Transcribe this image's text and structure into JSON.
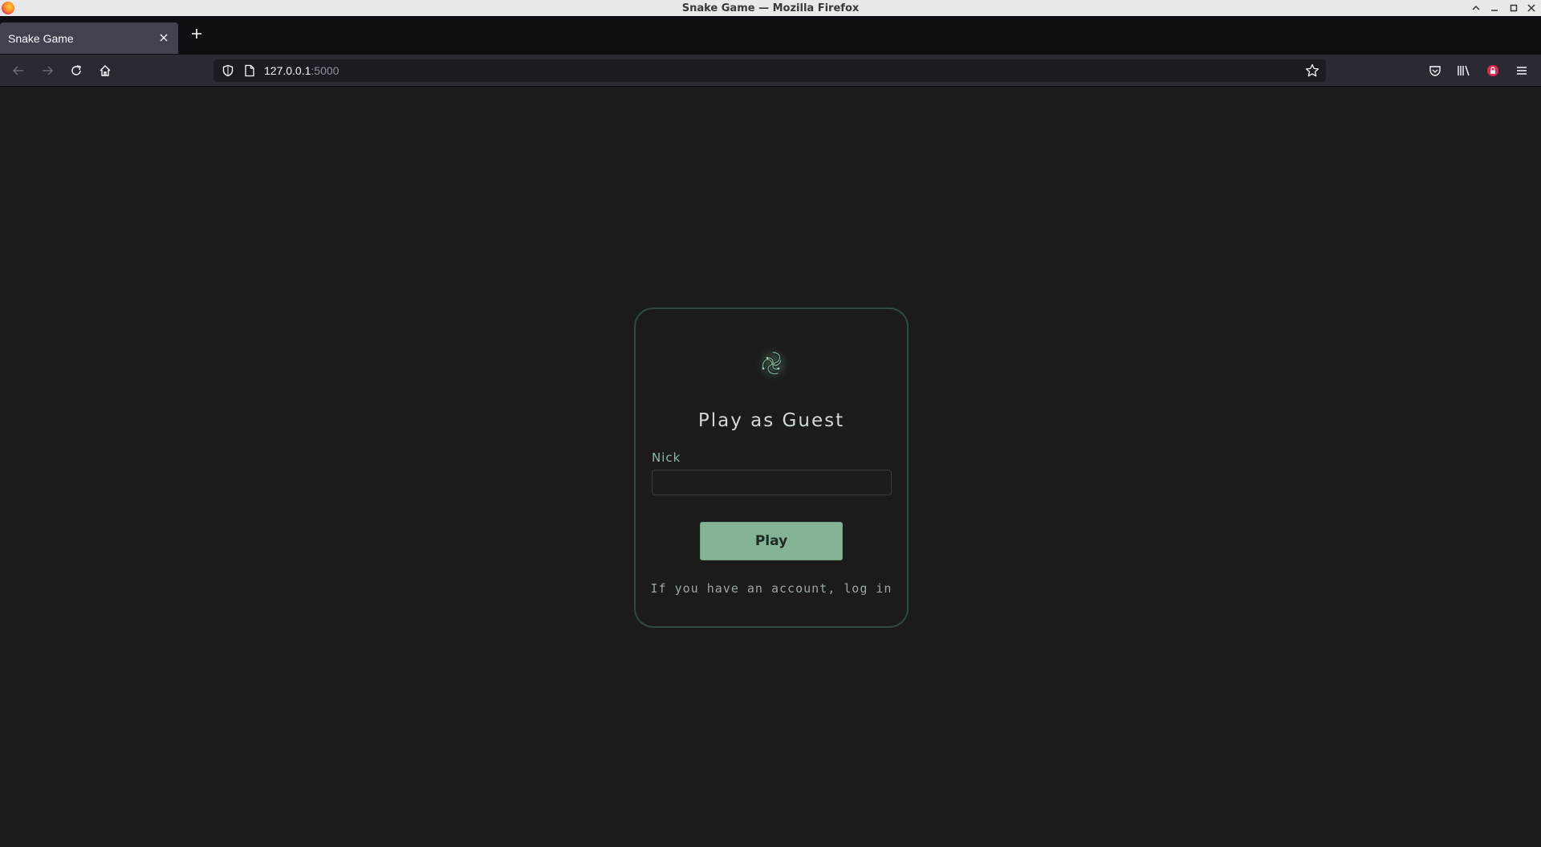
{
  "window": {
    "title": "Snake Game — Mozilla Firefox"
  },
  "tabs": [
    {
      "title": "Snake Game",
      "active": true
    }
  ],
  "navbar": {
    "url_host": "127.0.0.1",
    "url_port": ":5000"
  },
  "login_card": {
    "heading": "Play as Guest",
    "nick_label": "Nick",
    "nick_value": "",
    "play_label": "Play",
    "login_text": "If you have an account, log in"
  },
  "colors": {
    "card_border": "#2f4a3c",
    "button_bg": "#84b396",
    "page_bg": "#1c1b1c"
  },
  "icons": {
    "logo": "snake-swirl-logo-icon"
  }
}
